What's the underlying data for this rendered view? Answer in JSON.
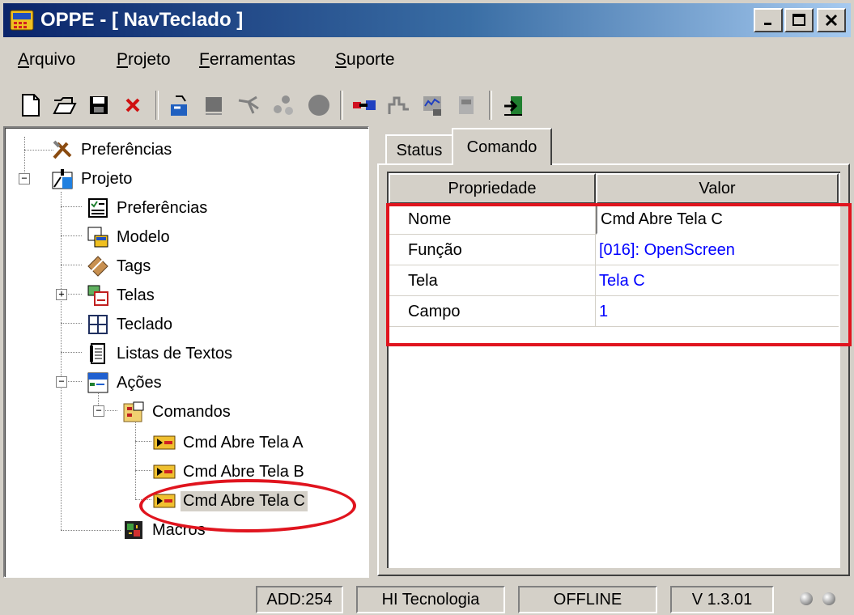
{
  "window": {
    "title": "OPPE - [ NavTeclado ]"
  },
  "menu": [
    {
      "label": "Arquivo",
      "mnemonic": "A",
      "rest": "rquivo"
    },
    {
      "label": "Projeto",
      "mnemonic": "P",
      "rest": "rojeto"
    },
    {
      "label": "Ferramentas",
      "mnemonic": "F",
      "rest": "erramentas"
    },
    {
      "label": "Suporte",
      "mnemonic": "S",
      "rest": "uporte"
    }
  ],
  "toolbar": {
    "buttons": [
      "new-file-icon",
      "open-folder-icon",
      "save-icon",
      "delete-icon",
      "transfer-icon",
      "module-icon",
      "connect-icon",
      "network-icon",
      "stop-icon",
      "link-icon",
      "signal-icon",
      "monitor-icon",
      "device-icon",
      "exit-icon"
    ]
  },
  "tree": {
    "items": [
      {
        "label": "Preferências",
        "icon": "tools-icon"
      },
      {
        "label": "Projeto",
        "icon": "project-icon",
        "expanded": true
      },
      {
        "label": "Preferências",
        "icon": "checklist-icon"
      },
      {
        "label": "Modelo",
        "icon": "model-icon"
      },
      {
        "label": "Tags",
        "icon": "tags-icon"
      },
      {
        "label": "Telas",
        "icon": "screens-icon",
        "expanded": false
      },
      {
        "label": "Teclado",
        "icon": "keyboard-icon"
      },
      {
        "label": "Listas de Textos",
        "icon": "text-list-icon"
      },
      {
        "label": "Ações",
        "icon": "actions-icon",
        "expanded": true
      },
      {
        "label": "Comandos",
        "icon": "commands-icon",
        "expanded": true
      },
      {
        "label": "Cmd Abre Tela A",
        "icon": "command-icon"
      },
      {
        "label": "Cmd Abre Tela B",
        "icon": "command-icon"
      },
      {
        "label": "Cmd Abre Tela C",
        "icon": "command-icon",
        "selected": true
      },
      {
        "label": "Macros",
        "icon": "macros-icon"
      }
    ]
  },
  "tabs": [
    {
      "label": "Status",
      "active": false
    },
    {
      "label": "Comando",
      "active": true
    }
  ],
  "grid": {
    "headers": {
      "property": "Propriedade",
      "value": "Valor"
    },
    "rows": [
      {
        "property": "Nome",
        "value": "Cmd Abre Tela C",
        "link": false
      },
      {
        "property": "Função",
        "value": "[016]: OpenScreen",
        "link": true
      },
      {
        "property": "Tela",
        "value": "Tela C",
        "link": true
      },
      {
        "property": "Campo",
        "value": "1",
        "link": true
      }
    ]
  },
  "statusbar": {
    "add": "ADD:254",
    "company": "HI Tecnologia",
    "mode": "OFFLINE",
    "version": "V 1.3.01"
  },
  "colors": {
    "title_start": "#0a246a",
    "title_end": "#a6caf0",
    "highlight": "#e0141e",
    "link": "#0000ff"
  }
}
